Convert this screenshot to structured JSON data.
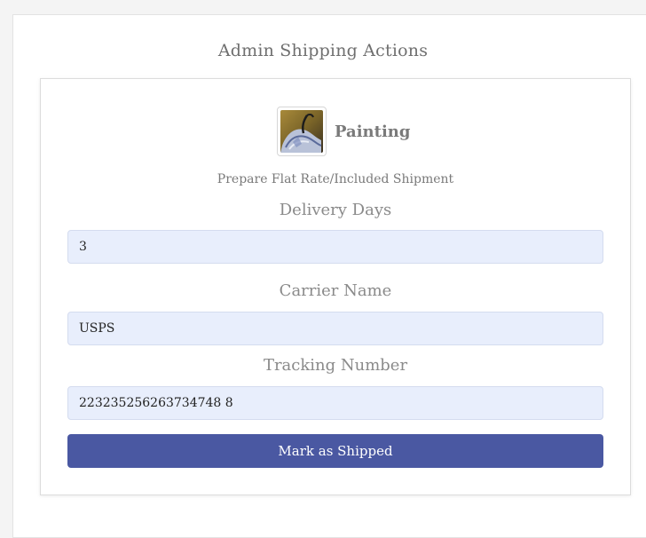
{
  "panel": {
    "title": "Admin Shipping Actions"
  },
  "product": {
    "name": "Painting",
    "thumbnail_icon": "painting-thumbnail-image"
  },
  "form": {
    "subtitle": "Prepare Flat Rate/Included Shipment",
    "delivery_days": {
      "label": "Delivery Days",
      "value": "3"
    },
    "carrier_name": {
      "label": "Carrier Name",
      "value": "USPS"
    },
    "tracking_number": {
      "label": "Tracking Number",
      "value": "223235256263734748 8"
    },
    "submit_label": "Mark as Shipped"
  },
  "colors": {
    "button_bg": "#4a58a2",
    "input_bg": "#e8eefc"
  }
}
